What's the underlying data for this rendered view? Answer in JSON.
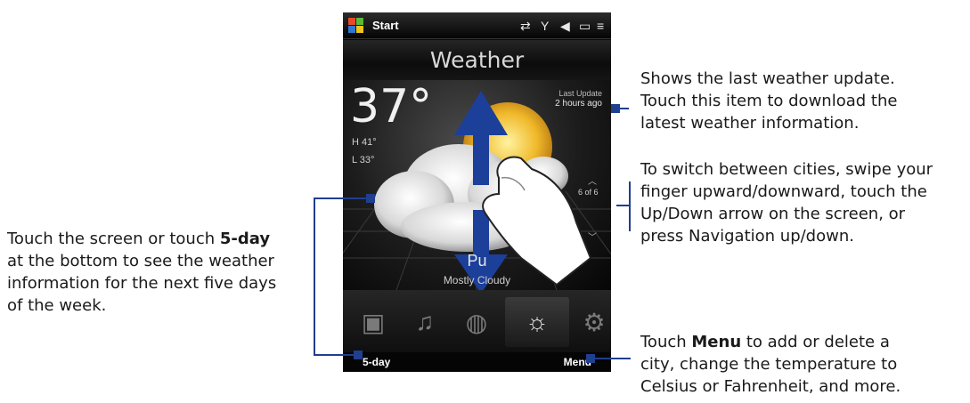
{
  "callouts": {
    "left": {
      "line1_a": "Touch the screen or touch ",
      "line1_b": "5-day",
      "line2": "at the bottom to see the weather",
      "line3": "information for the next five days",
      "line4": "of the week."
    },
    "update": {
      "line1": "Shows the last weather update.",
      "line2": "Touch this item to download the",
      "line3": "latest weather information."
    },
    "switch": {
      "line1": "To switch between cities, swipe your",
      "line2": "finger upward/downward, touch the",
      "line3": "Up/Down arrow on the screen, or",
      "line4": "press Navigation up/down."
    },
    "menu": {
      "line1_a": "Touch ",
      "line1_b": "Menu",
      "line1_c": " to add or delete a",
      "line2": "city, change the temperature to",
      "line3": "Celsius or Fahrenheit, and more."
    }
  },
  "phone": {
    "titlebar": {
      "start_label": "Start",
      "status_icons": [
        "sync-icon",
        "signal-icon",
        "volume-icon",
        "battery-icon",
        "menu-icon"
      ]
    },
    "weather": {
      "title": "Weather",
      "temperature": "37°",
      "high": "H  41°",
      "low": "L  33°",
      "last_update_label": "Last Update",
      "last_update_value": "2 hours ago",
      "city_counter": "6 of 6",
      "city_name": "Pu",
      "condition": "Mostly Cloudy"
    },
    "tabs": [
      "photos-icon",
      "music-icon",
      "internet-icon",
      "weather-icon",
      "settings-icon"
    ],
    "softkeys": {
      "left": "5-day",
      "right": "Menu"
    }
  },
  "colors": {
    "leader": "#1f3f8f",
    "arrow": "#1c3f9a"
  }
}
